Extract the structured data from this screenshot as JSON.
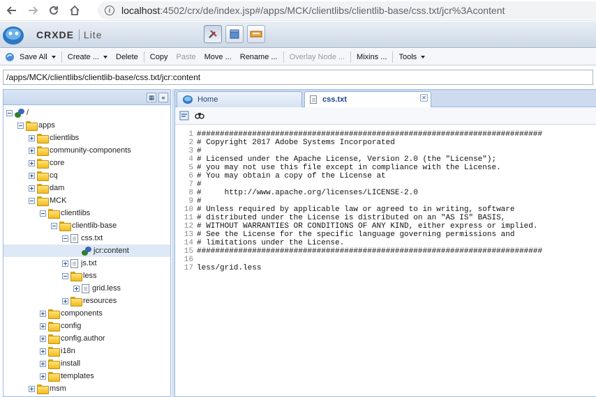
{
  "browser": {
    "url_host": "localhost",
    "url_path": ":4502/crx/de/index.jsp#/apps/MCK/clientlibs/clientlib-base/css.txt/jcr%3Acontent"
  },
  "app": {
    "logo_text": "CRXDE",
    "logo_sub": "Lite"
  },
  "toolbar": {
    "save_all": "Save All",
    "create": "Create ...",
    "delete": "Delete",
    "copy": "Copy",
    "paste": "Paste",
    "move": "Move ...",
    "rename": "Rename ...",
    "overlay_node": "Overlay Node ...",
    "mixins": "Mixins ...",
    "tools": "Tools"
  },
  "path_bar": {
    "value": "/apps/MCK/clientlibs/clientlib-base/css.txt/jcr:content"
  },
  "tree": {
    "nodes": [
      {
        "label": "/",
        "icon": "repository-icon",
        "toggle": "minus",
        "depth": 0
      },
      {
        "label": "apps",
        "icon": "folder-icon",
        "toggle": "minus",
        "depth": 1
      },
      {
        "label": "clientlibs",
        "icon": "folder-icon",
        "toggle": "plus",
        "depth": 2
      },
      {
        "label": "community-components",
        "icon": "folder-icon",
        "toggle": "plus",
        "depth": 2
      },
      {
        "label": "core",
        "icon": "folder-icon",
        "toggle": "plus",
        "depth": 2
      },
      {
        "label": "cq",
        "icon": "folder-icon",
        "toggle": "plus",
        "depth": 2
      },
      {
        "label": "dam",
        "icon": "folder-icon",
        "toggle": "plus",
        "depth": 2
      },
      {
        "label": "MCK",
        "icon": "folder-icon",
        "toggle": "minus",
        "depth": 2
      },
      {
        "label": "clientlibs",
        "icon": "folder-icon",
        "toggle": "minus",
        "depth": 3
      },
      {
        "label": "clientlib-base",
        "icon": "folder-icon",
        "toggle": "minus",
        "depth": 4
      },
      {
        "label": "css.txt",
        "icon": "file-icon",
        "toggle": "minus",
        "depth": 5
      },
      {
        "label": "jcr:content",
        "icon": "node-icon",
        "toggle": "none",
        "depth": 6,
        "selected": true
      },
      {
        "label": "js.txt",
        "icon": "file-icon",
        "toggle": "plus",
        "depth": 5
      },
      {
        "label": "less",
        "icon": "folder-icon",
        "toggle": "minus",
        "depth": 5
      },
      {
        "label": "grid.less",
        "icon": "file-icon",
        "toggle": "plus",
        "depth": 6
      },
      {
        "label": "resources",
        "icon": "folder-icon",
        "toggle": "plus",
        "depth": 5
      },
      {
        "label": "components",
        "icon": "folder-icon",
        "toggle": "plus",
        "depth": 3
      },
      {
        "label": "config",
        "icon": "folder-icon",
        "toggle": "plus",
        "depth": 3
      },
      {
        "label": "config.author",
        "icon": "folder-icon",
        "toggle": "plus",
        "depth": 3
      },
      {
        "label": "i18n",
        "icon": "folder-icon",
        "toggle": "plus",
        "depth": 3
      },
      {
        "label": "install",
        "icon": "folder-icon",
        "toggle": "plus",
        "depth": 3
      },
      {
        "label": "templates",
        "icon": "folder-icon",
        "toggle": "plus",
        "depth": 3
      },
      {
        "label": "msm",
        "icon": "folder-icon",
        "toggle": "plus",
        "depth": 2
      }
    ]
  },
  "tabs": [
    {
      "label": "Home",
      "active": false
    },
    {
      "label": "css.txt",
      "active": true
    }
  ],
  "editor": {
    "lines": [
      "###########################################################################",
      "# Copyright 2017 Adobe Systems Incorporated",
      "#",
      "# Licensed under the Apache License, Version 2.0 (the \"License\");",
      "# you may not use this file except in compliance with the License.",
      "# You may obtain a copy of the License at",
      "#",
      "#     http://www.apache.org/licenses/LICENSE-2.0",
      "#",
      "# Unless required by applicable law or agreed to in writing, software",
      "# distributed under the License is distributed on an \"AS IS\" BASIS,",
      "# WITHOUT WARRANTIES OR CONDITIONS OF ANY KIND, either express or implied.",
      "# See the License for the specific language governing permissions and",
      "# limitations under the License.",
      "###########################################################################",
      "",
      "less/grid.less"
    ]
  }
}
